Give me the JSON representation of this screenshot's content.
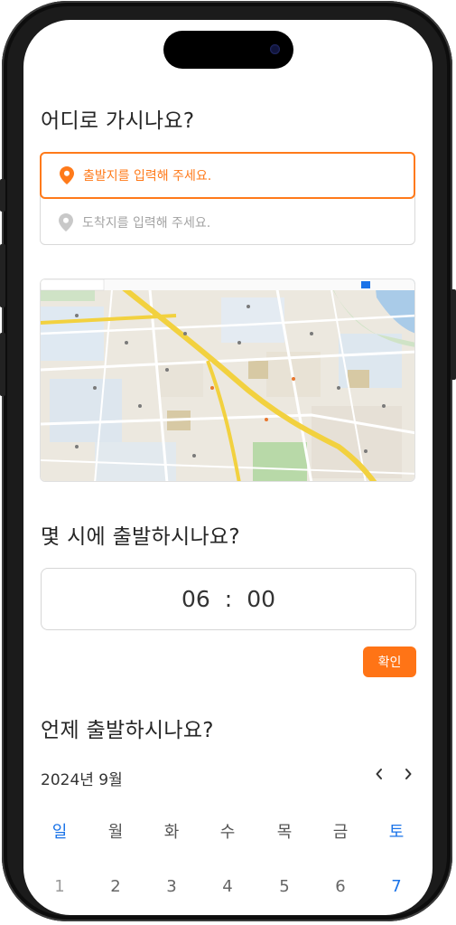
{
  "accent_color": "#ff7416",
  "route": {
    "title": "어디로 가시나요?",
    "start_placeholder": "출발지를 입력해 주세요.",
    "end_placeholder": "도착지를 입력해 주세요.",
    "start_icon": "location-pin-icon",
    "end_icon": "location-pin-icon"
  },
  "time": {
    "title": "몇 시에 출발하시나요?",
    "hour": "06",
    "separator": ":",
    "minute": "00",
    "confirm_label": "확인"
  },
  "date": {
    "title": "언제 출발하시나요?",
    "month_label": "2024년 9월",
    "prev_icon": "chevron-left-icon",
    "next_icon": "chevron-right-icon",
    "weekdays": [
      "일",
      "월",
      "화",
      "수",
      "목",
      "금",
      "토"
    ],
    "first_week": [
      "1",
      "2",
      "3",
      "4",
      "5",
      "6",
      "7"
    ]
  }
}
